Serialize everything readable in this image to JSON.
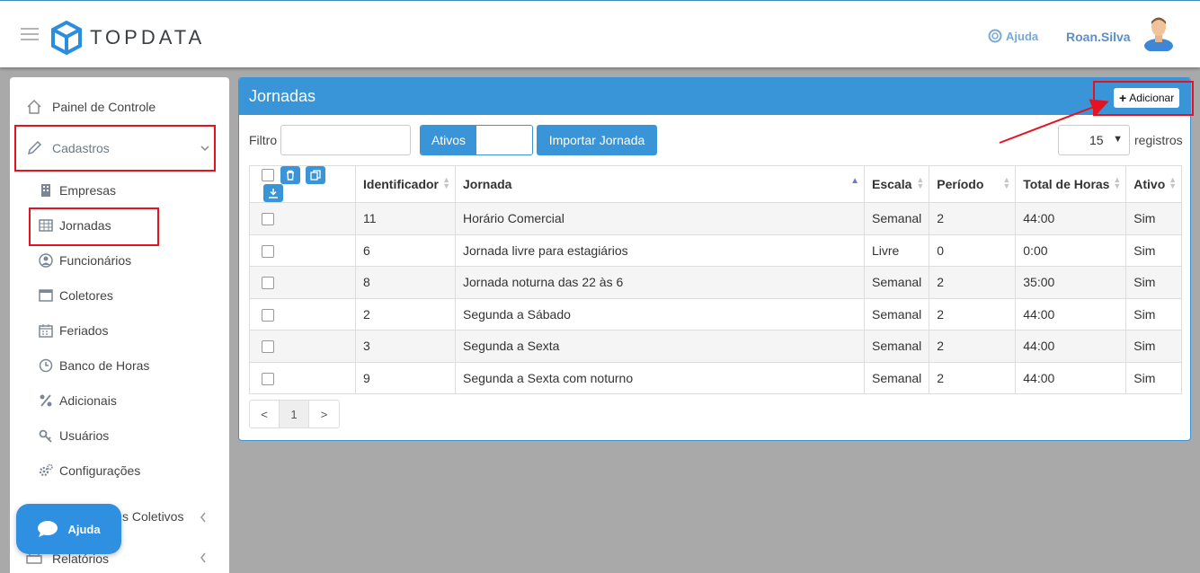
{
  "brand": {
    "name": "TOPDATA"
  },
  "header": {
    "help_label": "Ajuda",
    "user_name": "Roan.Silva"
  },
  "sidebar": {
    "items": [
      {
        "label": "Painel de Controle",
        "icon": "home-icon"
      },
      {
        "label": "Cadastros",
        "icon": "pencil-icon",
        "expanded": true
      }
    ],
    "subitems": [
      {
        "label": "Empresas",
        "icon": "building-icon"
      },
      {
        "label": "Jornadas",
        "icon": "table-icon",
        "active": true
      },
      {
        "label": "Funcionários",
        "icon": "user-circle-icon"
      },
      {
        "label": "Coletores",
        "icon": "window-icon"
      },
      {
        "label": "Feriados",
        "icon": "calendar-icon"
      },
      {
        "label": "Banco de Horas",
        "icon": "clock-icon"
      },
      {
        "label": "Adicionais",
        "icon": "percent-icon"
      },
      {
        "label": "Usuários",
        "icon": "key-icon"
      },
      {
        "label": "Configurações",
        "icon": "gears-icon"
      }
    ],
    "collapsed_items": [
      {
        "label": "s Coletivos",
        "icon": "chevron-left-icon"
      },
      {
        "label": "Relatórios",
        "icon": "chevron-left-icon"
      }
    ]
  },
  "fab": {
    "label": "Ajuda"
  },
  "panel": {
    "title": "Jornadas",
    "add_label": "Adicionar",
    "filter_label": "Filtro",
    "filter_value": "",
    "toggle_label": "Ativos",
    "import_label": "Importar Jornada",
    "page_size": "15",
    "page_size_suffix": "registros"
  },
  "table": {
    "columns": [
      "Identificador",
      "Jornada",
      "Escala",
      "Período",
      "Total de Horas",
      "Ativo"
    ],
    "rows": [
      [
        "11",
        "Horário Comercial",
        "Semanal",
        "2",
        "44:00",
        "Sim"
      ],
      [
        "6",
        "Jornada livre para estagiários",
        "Livre",
        "0",
        "0:00",
        "Sim"
      ],
      [
        "8",
        "Jornada noturna das 22 às 6",
        "Semanal",
        "2",
        "35:00",
        "Sim"
      ],
      [
        "2",
        "Segunda a Sábado",
        "Semanal",
        "2",
        "44:00",
        "Sim"
      ],
      [
        "3",
        "Segunda a Sexta",
        "Semanal",
        "2",
        "44:00",
        "Sim"
      ],
      [
        "9",
        "Segunda a Sexta com noturno",
        "Semanal",
        "2",
        "44:00",
        "Sim"
      ]
    ]
  },
  "pagination": {
    "prev": "<",
    "current": "1",
    "next": ">"
  },
  "colors": {
    "primary": "#3a94d8",
    "highlight": "#e5131f",
    "background": "#a9a9a9"
  }
}
